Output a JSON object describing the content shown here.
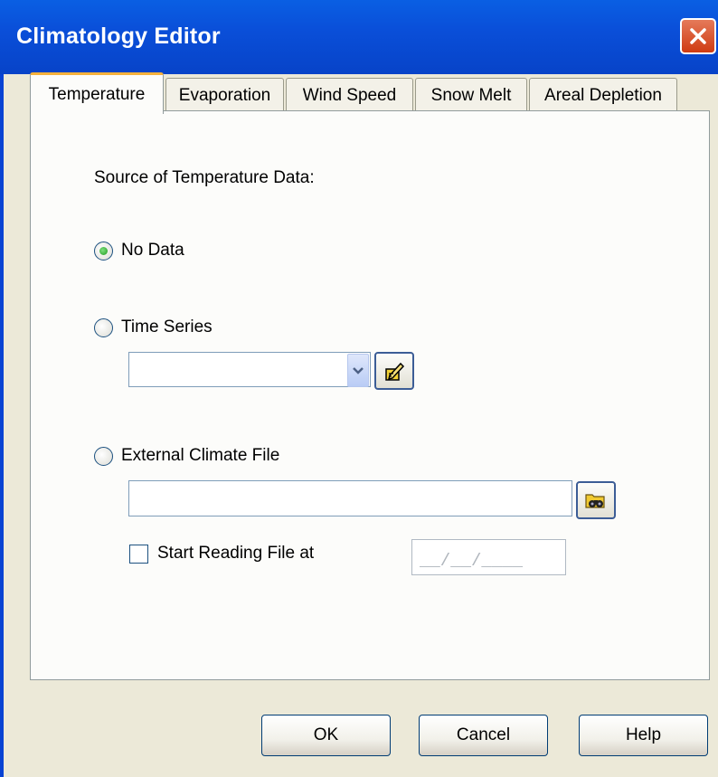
{
  "window": {
    "title": "Climatology Editor"
  },
  "tabs": [
    {
      "label": "Temperature",
      "active": true
    },
    {
      "label": "Evaporation",
      "active": false
    },
    {
      "label": "Wind Speed",
      "active": false
    },
    {
      "label": "Snow Melt",
      "active": false
    },
    {
      "label": "Areal Depletion",
      "active": false
    }
  ],
  "temperature": {
    "source_label": "Source of Temperature Data:",
    "options": [
      {
        "label": "No Data",
        "selected": true
      },
      {
        "label": "Time Series",
        "selected": false
      },
      {
        "label": "External Climate File",
        "selected": false
      }
    ],
    "time_series_value": "",
    "climate_file_value": "",
    "start_reading_label": "Start Reading File at",
    "start_reading_checked": false,
    "start_date_mask": "__/__/____"
  },
  "buttons": {
    "ok": "OK",
    "cancel": "Cancel",
    "help": "Help"
  },
  "colors": {
    "title_bar": "#0a52dd",
    "close_button": "#d9532a",
    "tab_accent": "#f5b13c",
    "radio_selected": "#2aa52a"
  },
  "icons": {
    "close": "close-icon",
    "combo": "chevron-down-icon",
    "edit": "edit-pencil-icon",
    "browse": "browse-binoculars-icon"
  }
}
